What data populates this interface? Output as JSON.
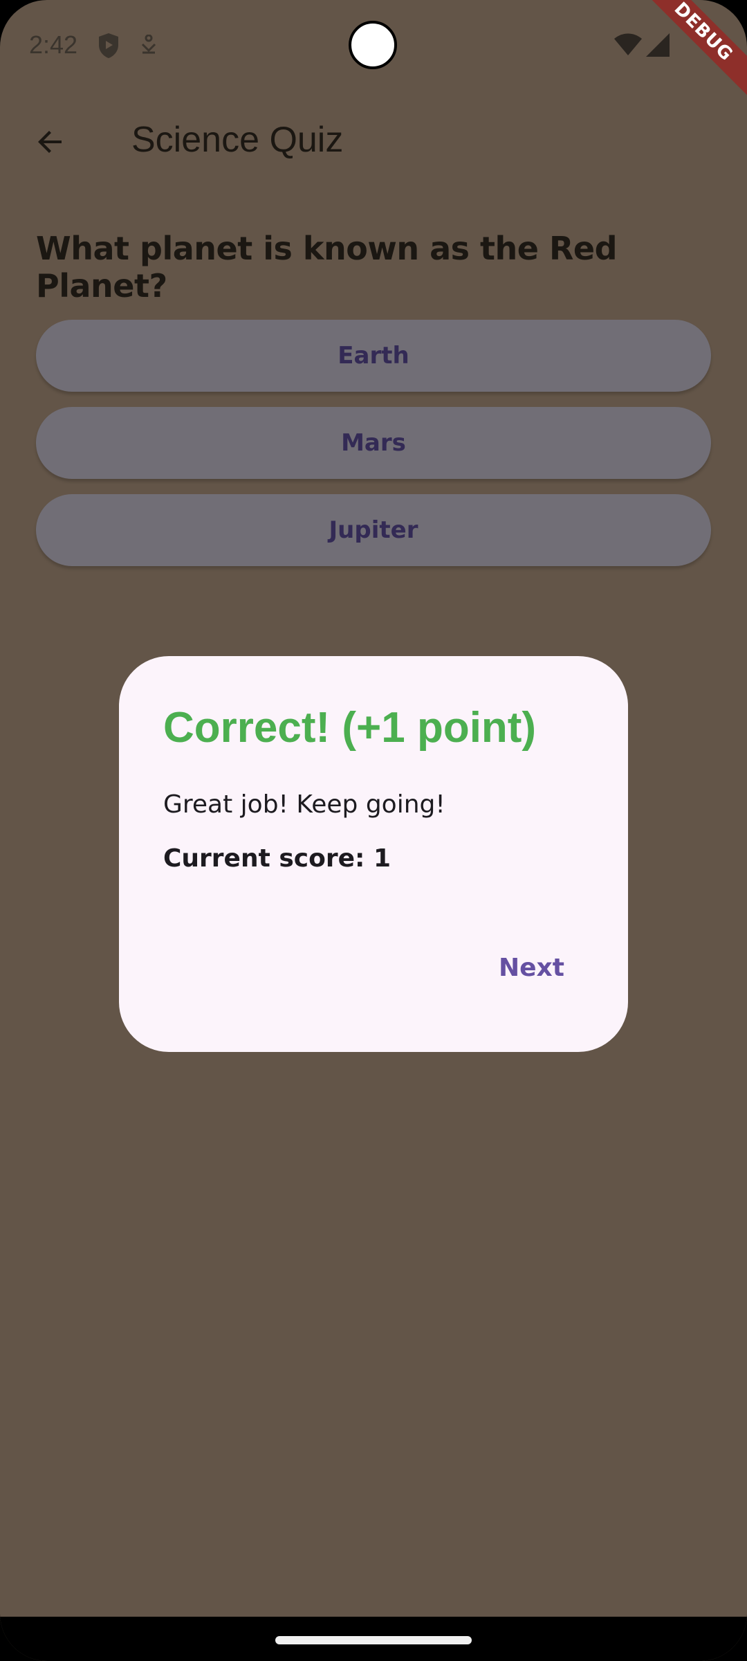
{
  "status_bar": {
    "time": "2:42"
  },
  "debug_banner": "DEBUG",
  "app_bar": {
    "title": "Science Quiz"
  },
  "question": {
    "text": "What planet is known as the Red Planet?"
  },
  "answers": [
    {
      "label": "Earth"
    },
    {
      "label": "Mars"
    },
    {
      "label": "Jupiter"
    }
  ],
  "dialog": {
    "title": "Correct! (+1 point)",
    "message": "Great job! Keep going!",
    "score": "Current score: 1",
    "next_label": "Next"
  },
  "colors": {
    "background": "#635548",
    "dialog_background": "#fcf4fb",
    "success": "#4caf50",
    "accent": "#6550a2"
  }
}
